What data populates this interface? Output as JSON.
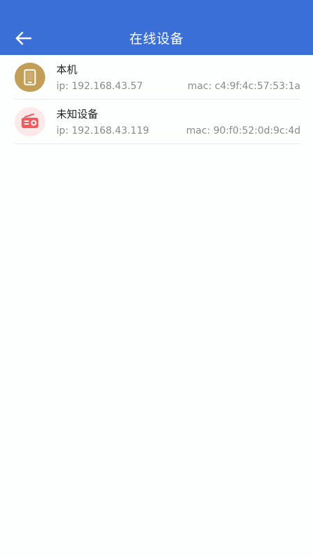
{
  "header": {
    "title": "在线设备",
    "back_icon": "arrow-left-icon",
    "background_color": "#3a6fd8"
  },
  "devices": [
    {
      "name": "本机",
      "ip": "ip: 192.168.43.57",
      "mac": "mac: c4:9f:4c:57:53:1a",
      "icon": "phone-icon",
      "icon_color": "#c39e57"
    },
    {
      "name": "未知设备",
      "ip": "ip: 192.168.43.119",
      "mac": "mac: 90:f0:52:0d:9c:4d",
      "icon": "radio-icon",
      "icon_color": "#f15b5d"
    }
  ],
  "colors": {
    "page_background": "#fdfefe",
    "divider": "#e9ecef",
    "primary_text": "#202020",
    "secondary_text": "#8a8a8a"
  }
}
